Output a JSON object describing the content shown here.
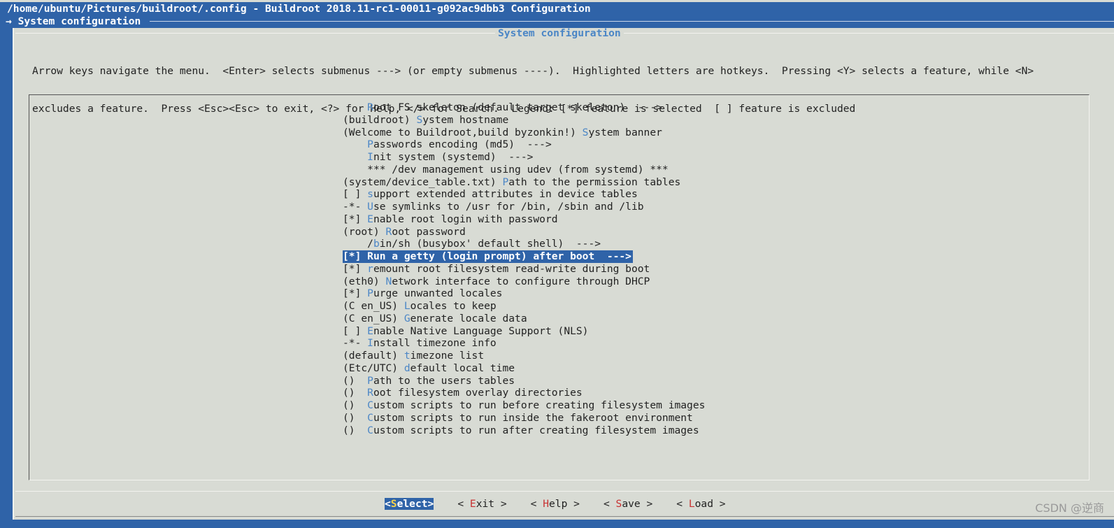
{
  "window": {
    "title": "/home/ubuntu/Pictures/buildroot/.config - Buildroot 2018.11-rc1-00011-g092ac9dbb3 Configuration",
    "breadcrumb": "→ System configuration"
  },
  "dialog": {
    "title": "System configuration",
    "help_line1": "Arrow keys navigate the menu.  <Enter> selects submenus ---> (or empty submenus ----).  Highlighted letters are hotkeys.  Pressing <Y> selects a feature, while <N>",
    "help_line2": "excludes a feature.  Press <Esc><Esc> to exit, <?> for Help, </> for Search.  Legend: [*] feature is selected  [ ] feature is excluded"
  },
  "menu": {
    "selected_index": 12,
    "items": [
      {
        "pre": "    ",
        "hotkey": "R",
        "rest": "oot FS skeleton (default target skeleton)  --->"
      },
      {
        "pre": "(buildroot) ",
        "hotkey": "S",
        "rest": "ystem hostname"
      },
      {
        "pre": "(Welcome to Buildroot,build byzonkin!) ",
        "hotkey": "S",
        "rest": "ystem banner"
      },
      {
        "pre": "    ",
        "hotkey": "P",
        "rest": "asswords encoding (md5)  --->"
      },
      {
        "pre": "    ",
        "hotkey": "I",
        "rest": "nit system (systemd)  --->"
      },
      {
        "pre": "    ",
        "hotkey": "",
        "rest": "*** /dev management using udev (from systemd) ***"
      },
      {
        "pre": "(system/device_table.txt) ",
        "hotkey": "P",
        "rest": "ath to the permission tables"
      },
      {
        "pre": "[ ] ",
        "hotkey": "s",
        "rest": "upport extended attributes in device tables"
      },
      {
        "pre": "-*- ",
        "hotkey": "U",
        "rest": "se symlinks to /usr for /bin, /sbin and /lib"
      },
      {
        "pre": "[*] ",
        "hotkey": "E",
        "rest": "nable root login with password"
      },
      {
        "pre": "(root) ",
        "hotkey": "R",
        "rest": "oot password"
      },
      {
        "pre": "    /",
        "hotkey": "b",
        "rest": "in/sh (busybox' default shell)  --->"
      },
      {
        "pre": "[*] ",
        "hotkey": "R",
        "rest": "un a getty (login prompt) after boot  --->"
      },
      {
        "pre": "[*] ",
        "hotkey": "r",
        "rest": "emount root filesystem read-write during boot"
      },
      {
        "pre": "(eth0) ",
        "hotkey": "N",
        "rest": "etwork interface to configure through DHCP"
      },
      {
        "pre": "[*] ",
        "hotkey": "P",
        "rest": "urge unwanted locales"
      },
      {
        "pre": "(C en_US) ",
        "hotkey": "L",
        "rest": "ocales to keep"
      },
      {
        "pre": "(C en_US) ",
        "hotkey": "G",
        "rest": "enerate locale data"
      },
      {
        "pre": "[ ] ",
        "hotkey": "E",
        "rest": "nable Native Language Support (NLS)"
      },
      {
        "pre": "-*- ",
        "hotkey": "I",
        "rest": "nstall timezone info"
      },
      {
        "pre": "(default) ",
        "hotkey": "t",
        "rest": "imezone list"
      },
      {
        "pre": "(Etc/UTC) ",
        "hotkey": "d",
        "rest": "efault local time"
      },
      {
        "pre": "()  ",
        "hotkey": "P",
        "rest": "ath to the users tables"
      },
      {
        "pre": "()  ",
        "hotkey": "R",
        "rest": "oot filesystem overlay directories"
      },
      {
        "pre": "()  ",
        "hotkey": "C",
        "rest": "ustom scripts to run before creating filesystem images"
      },
      {
        "pre": "()  ",
        "hotkey": "C",
        "rest": "ustom scripts to run inside the fakeroot environment"
      },
      {
        "pre": "()  ",
        "hotkey": "C",
        "rest": "ustom scripts to run after creating filesystem images"
      }
    ]
  },
  "buttons": {
    "select": {
      "pre": "<",
      "hotkey": "S",
      "rest": "elect>"
    },
    "exit": {
      "pre": "< ",
      "hotkey": "E",
      "rest": "xit >"
    },
    "help": {
      "pre": "< ",
      "hotkey": "H",
      "rest": "elp >"
    },
    "save": {
      "pre": "< ",
      "hotkey": "S",
      "rest": "ave >"
    },
    "load": {
      "pre": "< ",
      "hotkey": "L",
      "rest": "oad >"
    }
  },
  "watermark": "CSDN @逆商",
  "colors": {
    "terminal_blue": "#2f63a8",
    "dialog_gray": "#d8dbd4",
    "hotkey_blue": "#4b86c6",
    "button_hotkey_red": "#c83232",
    "active_button_hotkey_yellow": "#f7d24c"
  }
}
